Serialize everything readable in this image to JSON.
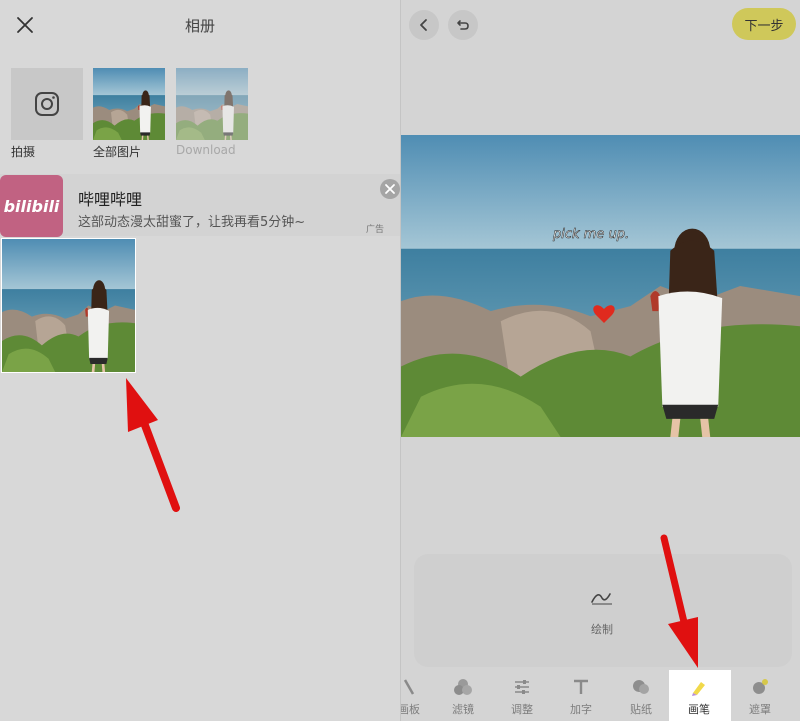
{
  "album": {
    "title": "相册",
    "camera_label": "拍摄",
    "all_photos_label": "全部图片",
    "download_label": "Download"
  },
  "ad": {
    "logo_text": "bilibili",
    "title": "哔哩哔哩",
    "description": "这部动态漫太甜蜜了，让我再看5分钟~",
    "tag": "广告"
  },
  "editor": {
    "next_label": "下一步",
    "overlay_text": "pick me up.",
    "tool_label": "绘制",
    "tabs": [
      {
        "label": "画板",
        "icon": "board-icon"
      },
      {
        "label": "滤镜",
        "icon": "filter-icon"
      },
      {
        "label": "调整",
        "icon": "adjust-icon"
      },
      {
        "label": "加字",
        "icon": "text-icon"
      },
      {
        "label": "贴纸",
        "icon": "sticker-icon"
      },
      {
        "label": "画笔",
        "icon": "brush-icon"
      },
      {
        "label": "遮罩",
        "icon": "mask-icon"
      }
    ],
    "selected_tab": "画笔"
  },
  "colors": {
    "next_button": "#cfc85a",
    "bilibili_pink": "#c16282",
    "arrow_red": "#e01010"
  }
}
